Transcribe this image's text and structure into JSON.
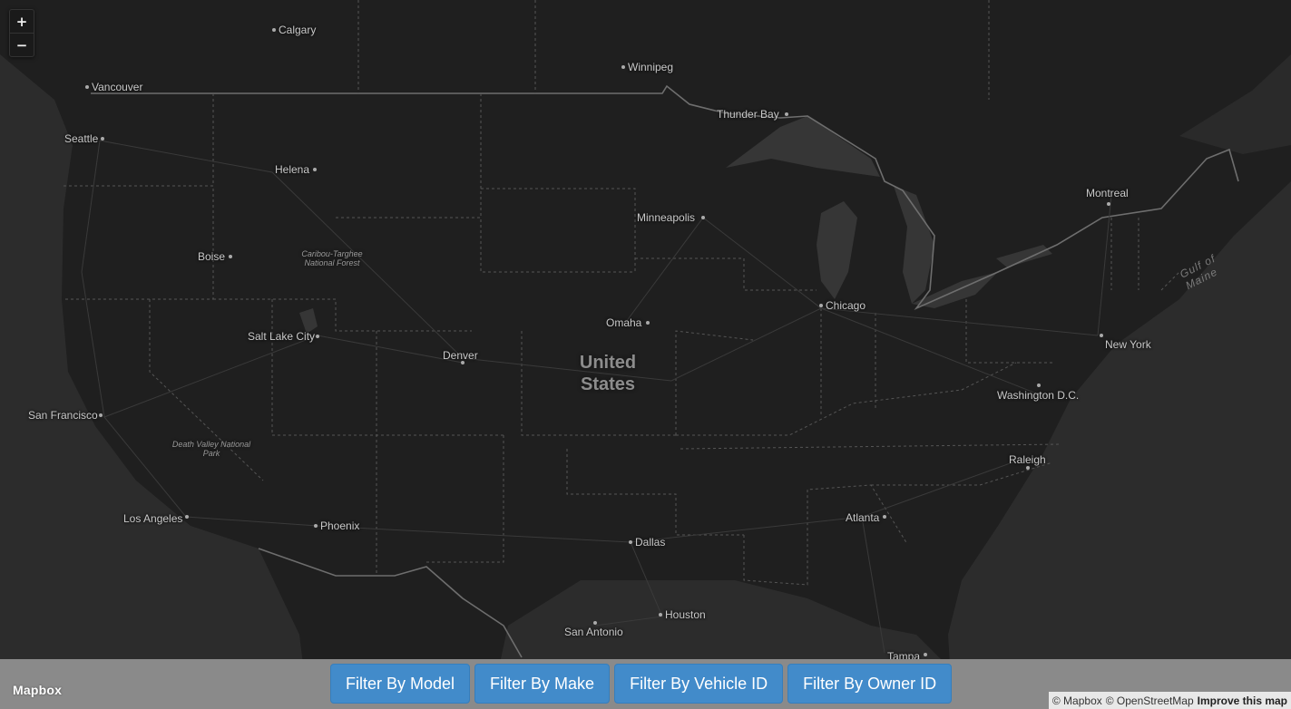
{
  "map": {
    "country_label_line1": "United",
    "country_label_line2": "States",
    "water_label": "Gulf of Maine",
    "cities": [
      {
        "name": "Calgary"
      },
      {
        "name": "Winnipeg"
      },
      {
        "name": "Vancouver"
      },
      {
        "name": "Thunder Bay"
      },
      {
        "name": "Seattle"
      },
      {
        "name": "Helena"
      },
      {
        "name": "Montreal"
      },
      {
        "name": "Minneapolis"
      },
      {
        "name": "Boise"
      },
      {
        "name": "Chicago"
      },
      {
        "name": "Omaha"
      },
      {
        "name": "Salt Lake City"
      },
      {
        "name": "New York"
      },
      {
        "name": "Denver"
      },
      {
        "name": "Washington D.C."
      },
      {
        "name": "San Francisco"
      },
      {
        "name": "Raleigh"
      },
      {
        "name": "Los Angeles"
      },
      {
        "name": "Atlanta"
      },
      {
        "name": "Phoenix"
      },
      {
        "name": "Dallas"
      },
      {
        "name": "Houston"
      },
      {
        "name": "San Antonio"
      },
      {
        "name": "Tampa"
      }
    ],
    "parks": [
      {
        "line1": "Caribou-Targhee",
        "line2": "National Forest"
      },
      {
        "line1": "Death Valley National",
        "line2": "Park"
      }
    ]
  },
  "zoom": {
    "in_label": "+",
    "out_label": "−"
  },
  "filters": [
    {
      "label": "Filter By Model"
    },
    {
      "label": "Filter By Make"
    },
    {
      "label": "Filter By Vehicle ID"
    },
    {
      "label": "Filter By Owner ID"
    }
  ],
  "brand": "Mapbox",
  "attribution": {
    "mapbox": "© Mapbox",
    "osm": "© OpenStreetMap",
    "improve": "Improve this map"
  },
  "colors": {
    "land": "#1e1e1e",
    "water": "#2f2f2f",
    "button": "#428bca",
    "bar": "#8a8a8a"
  }
}
